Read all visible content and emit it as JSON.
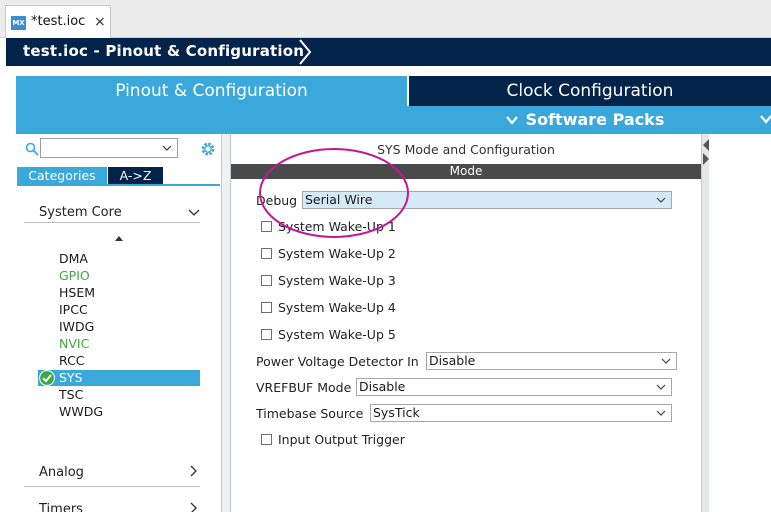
{
  "editor_tab": {
    "icon_text": "MX",
    "title": "*test.ioc",
    "close": "×"
  },
  "breadcrumb": {
    "text": "test.ioc - Pinout & Configuration"
  },
  "main_tabs": {
    "pinout": "Pinout & Configuration",
    "clock": "Clock Configuration"
  },
  "software_packs": {
    "chevron": "⌄",
    "label": "Software Packs"
  },
  "left_panel": {
    "search": {
      "value": "",
      "dropdown_chevron": "⌵"
    },
    "tabs": {
      "categories": "Categories",
      "az": "A->Z"
    },
    "system_core": {
      "label": "System Core",
      "arrow": "⌄",
      "sort_glyph": "▲",
      "items": [
        "DMA",
        "GPIO",
        "HSEM",
        "IPCC",
        "IWDG",
        "NVIC",
        "RCC",
        "SYS",
        "TSC",
        "WWDG"
      ],
      "selected": "SYS"
    },
    "analog": {
      "label": "Analog",
      "arrow": "›"
    },
    "timers": {
      "label": "Timers",
      "arrow": "›"
    }
  },
  "center_panel": {
    "title": "SYS Mode and Configuration",
    "mode_header": "Mode",
    "debug": {
      "label": "Debug",
      "value": "Serial Wire"
    },
    "wakeups": [
      "System Wake-Up 1",
      "System Wake-Up 2",
      "System Wake-Up 3",
      "System Wake-Up 4",
      "System Wake-Up 5"
    ],
    "pvd": {
      "label": "Power Voltage Detector In",
      "value": "Disable"
    },
    "vrefbuf": {
      "label": "VREFBUF Mode",
      "value": "Disable"
    },
    "timebase": {
      "label": "Timebase Source",
      "value": "SysTick"
    },
    "input_output_trigger": "Input Output Trigger",
    "select_chevron": "⌄"
  },
  "colors": {
    "navy": "#03234b",
    "accent_blue": "#3ba8dc",
    "mode_header_gray": "#4a4a4a",
    "green_periph": "#3ea83e",
    "annotation_magenta": "#c0189a"
  }
}
